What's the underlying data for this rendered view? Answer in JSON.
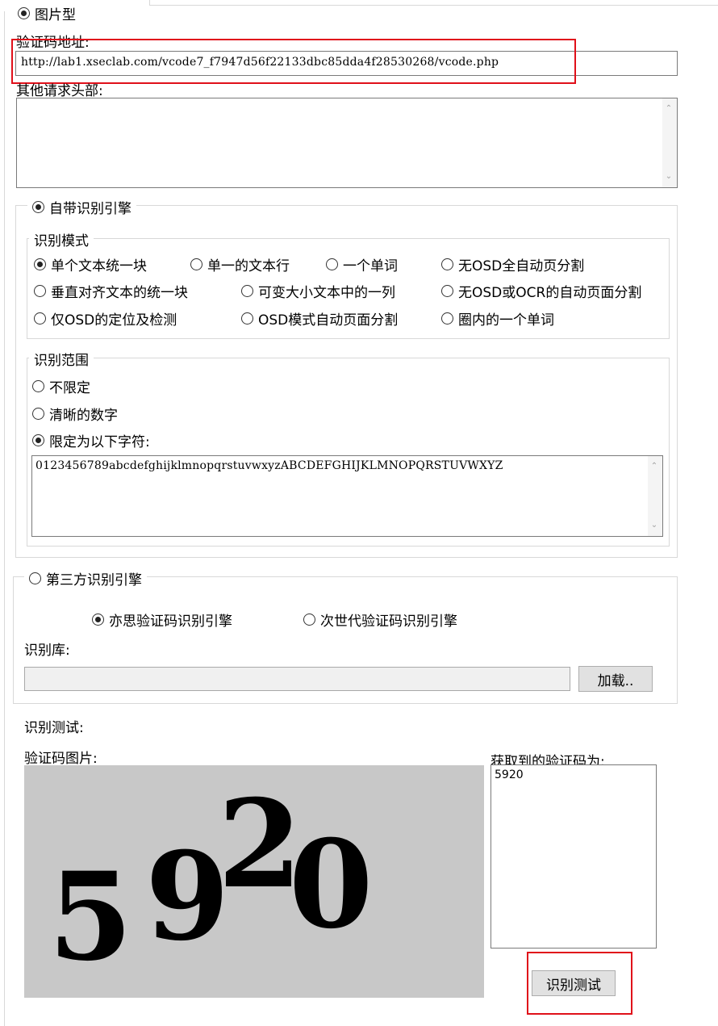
{
  "image_type": {
    "label": "图片型",
    "selected": true
  },
  "vcode_url": {
    "label": "验证码地址:",
    "value": "http://lab1.xseclab.com/vcode7_f7947d56f22133dbc85dda4f28530268/vcode.php"
  },
  "extra_headers": {
    "label": "其他请求头部:",
    "value": ""
  },
  "builtin_engine": {
    "label": "自带识别引擎",
    "selected": true,
    "mode_group": {
      "label": "识别模式",
      "options": [
        {
          "label": "单个文本统一块",
          "selected": true
        },
        {
          "label": "单一的文本行",
          "selected": false
        },
        {
          "label": "一个单词",
          "selected": false
        },
        {
          "label": "无OSD全自动页分割",
          "selected": false
        },
        {
          "label": "垂直对齐文本的统一块",
          "selected": false
        },
        {
          "label": "可变大小文本中的一列",
          "selected": false
        },
        {
          "label": "无OSD或OCR的自动页面分割",
          "selected": false
        },
        {
          "label": "仅OSD的定位及检测",
          "selected": false
        },
        {
          "label": "OSD模式自动页面分割",
          "selected": false
        },
        {
          "label": "圈内的一个单词",
          "selected": false
        }
      ]
    },
    "range_group": {
      "label": "识别范围",
      "options": [
        {
          "label": "不限定",
          "selected": false
        },
        {
          "label": "清晰的数字",
          "selected": false
        },
        {
          "label": "限定为以下字符:",
          "selected": true
        }
      ],
      "charset": "0123456789abcdefghijklmnopqrstuvwxyzABCDEFGHIJKLMNOPQRSTUVWXYZ"
    }
  },
  "third_party_engine": {
    "label": "第三方识别引擎",
    "selected": false,
    "options": [
      {
        "label": "亦思验证码识别引擎",
        "selected": true
      },
      {
        "label": "次世代验证码识别引擎",
        "selected": false
      }
    ],
    "library_label": "识别库:",
    "library_value": "",
    "load_button": "加载.."
  },
  "test": {
    "section_label": "识别测试:",
    "image_label": "验证码图片:",
    "captcha_text": "5920",
    "result_label": "获取到的验证码为:",
    "result_value": "5920",
    "test_button": "识别测试"
  },
  "colors": {
    "highlight": "#e0101a",
    "captcha_bg": "#c8c8c8",
    "disabled_field": "#f0f0f0"
  }
}
